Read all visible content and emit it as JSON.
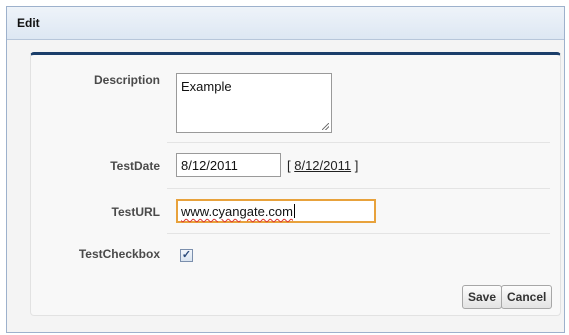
{
  "dialog": {
    "title": "Edit"
  },
  "form": {
    "description": {
      "label": "Description",
      "value": "Example"
    },
    "test_date": {
      "label": "TestDate",
      "value": "8/12/2011",
      "today_link": "8/12/2011",
      "bracket_open": "[ ",
      "bracket_close": " ]"
    },
    "test_url": {
      "label": "TestURL",
      "value": "www.cyangate.com"
    },
    "test_checkbox": {
      "label": "TestCheckbox",
      "checked": true,
      "glyph": "✓"
    }
  },
  "buttons": {
    "save": "Save",
    "cancel": "Cancel"
  },
  "colors": {
    "panel_top_border": "#1b3e6a",
    "focus_border": "#e8a23c",
    "dialog_border": "#9db1cc"
  }
}
